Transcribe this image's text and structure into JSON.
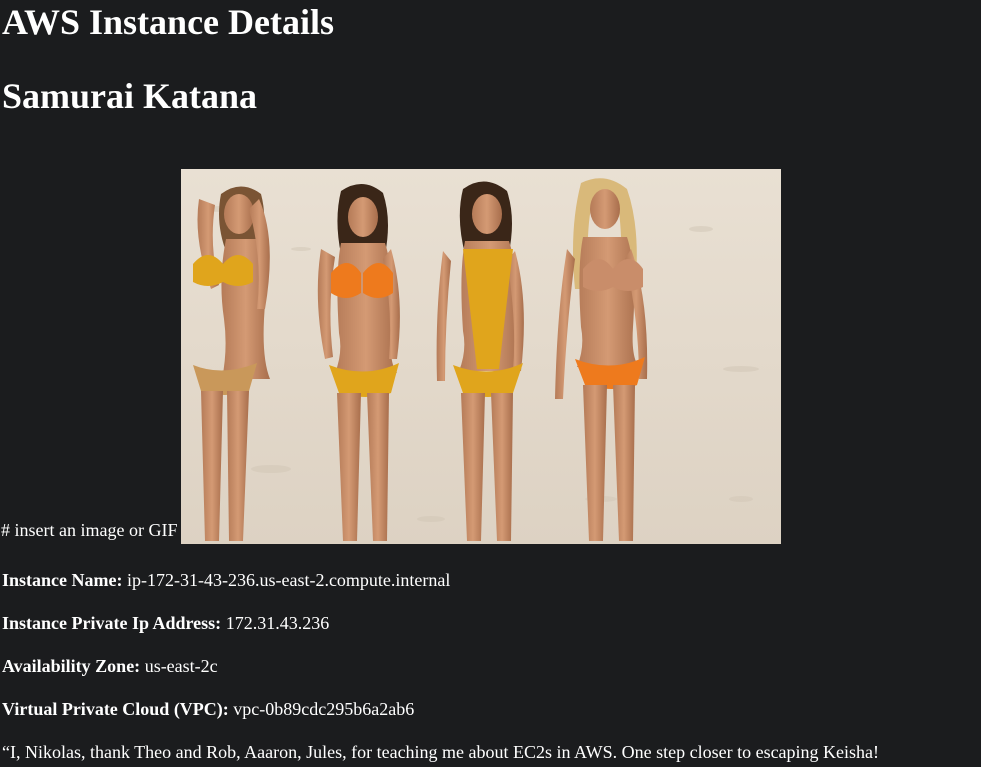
{
  "page": {
    "title": "AWS Instance Details",
    "subtitle": "Samurai Katana"
  },
  "image_section": {
    "caption": "# insert an image or GIF",
    "image_alt": "Four women walking on a sandy beach in swimsuits"
  },
  "details": [
    {
      "label": "Instance Name:",
      "value": "ip-172-31-43-236.us-east-2.compute.internal"
    },
    {
      "label": "Instance Private Ip Address:",
      "value": "172.31.43.236"
    },
    {
      "label": "Availability Zone:",
      "value": "us-east-2c"
    },
    {
      "label": "Virtual Private Cloud (VPC):",
      "value": "vpc-0b89cdc295b6a2ab6"
    }
  ],
  "thanks": "“I, Nikolas, thank Theo and Rob, Aaaron, Jules, for teaching me about EC2s in AWS. One step closer to escaping Keisha!",
  "colors": {
    "background": "#1b1c1e",
    "text": "#ffffff"
  }
}
